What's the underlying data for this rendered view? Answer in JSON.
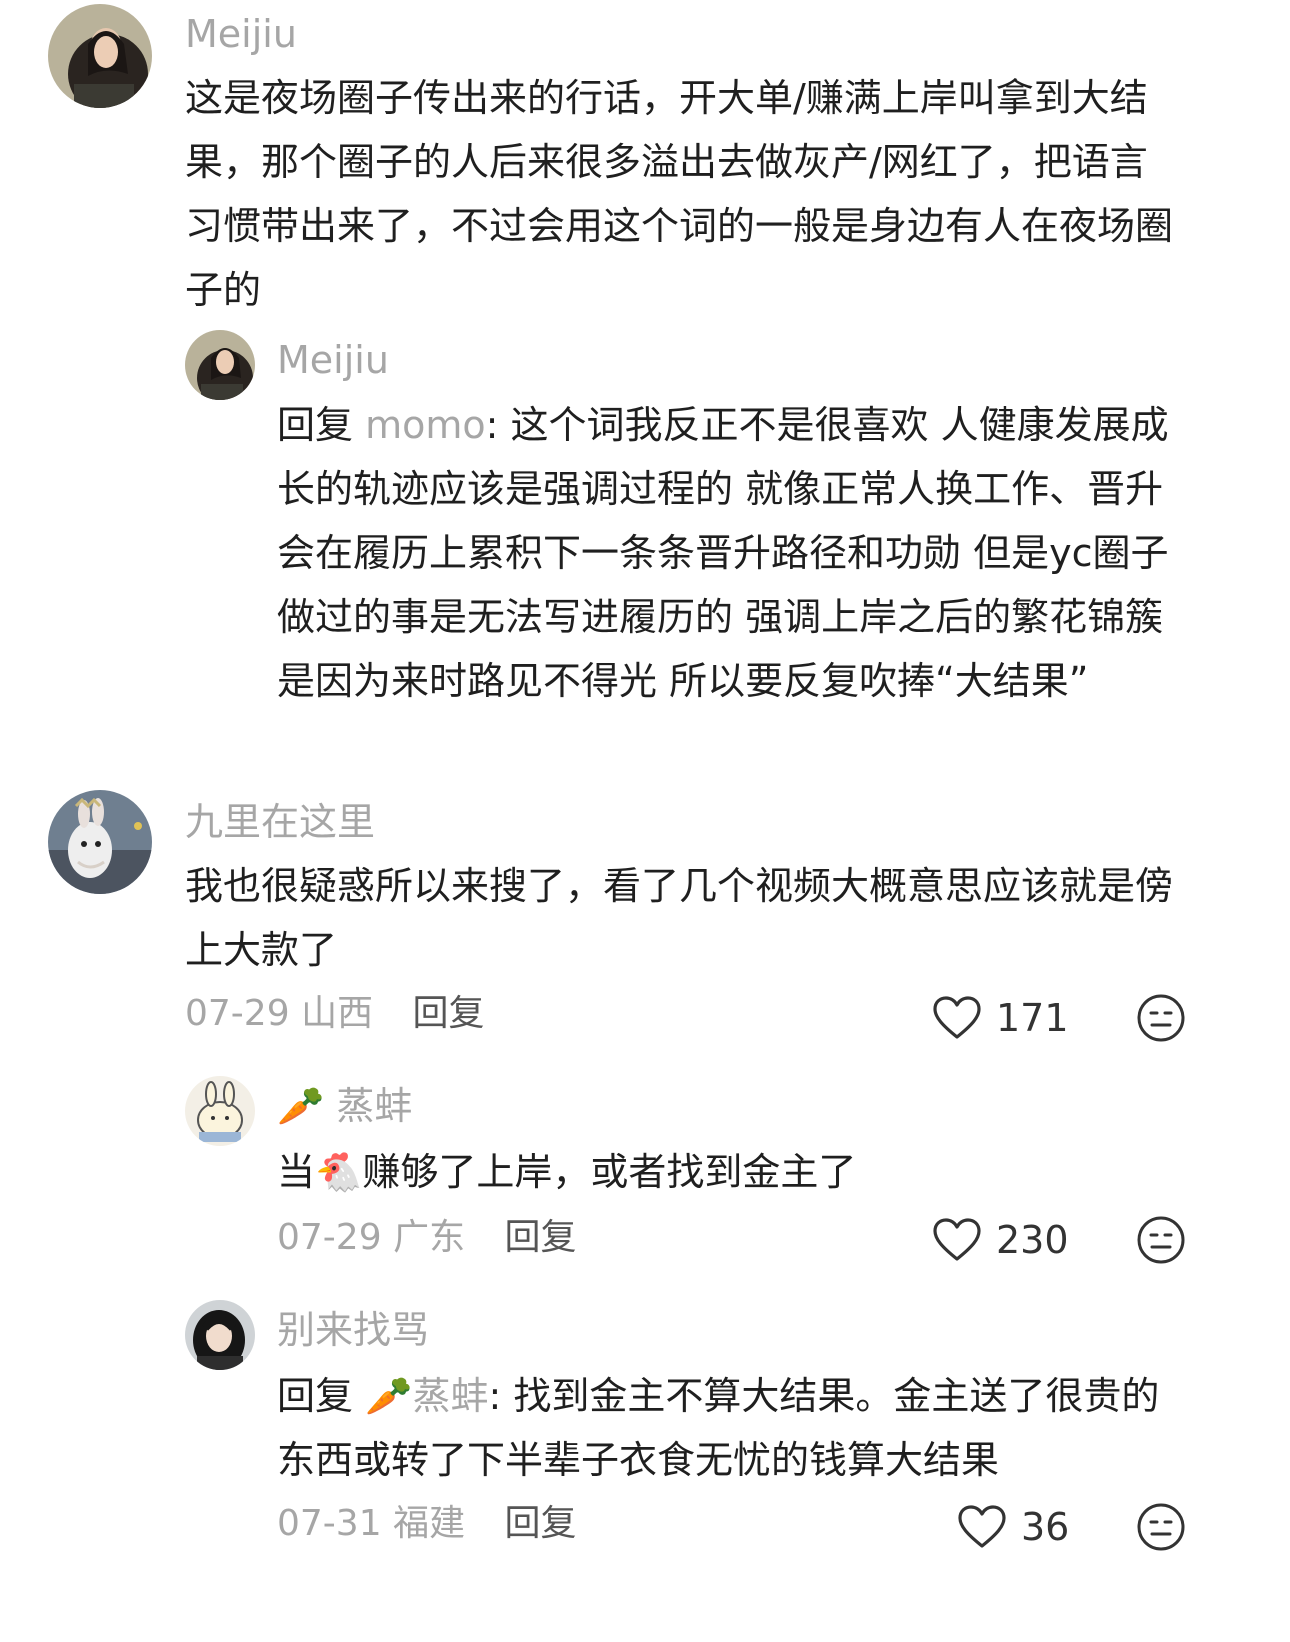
{
  "comments": [
    {
      "name": "Meijiu",
      "avatar": "woman-photo-avatar",
      "text": "这是夜场圈子传出来的行话，开大单/赚满上岸叫拿到大结果，那个圈子的人后来很多溢出去做灰产/网红了，把语言习惯带出来了，不过会用这个词的一般是身边有人在夜场圈子的",
      "replies": [
        {
          "name": "Meijiu",
          "avatar": "woman-photo-avatar",
          "reply_prefix": "回复",
          "mention": "momo",
          "text": ": 这个词我反正不是很喜欢 人健康发展成长的轨迹应该是强调过程的 就像正常人换工作、晋升会在履历上累积下一条条晋升路径和功勋 但是yc圈子做过的事是无法写进履历的 强调上岸之后的繁花锦簇 是因为来时路见不得光 所以要反复吹捧“大结果”"
        }
      ]
    },
    {
      "name": "九里在这里",
      "avatar": "rabbit-photo-avatar",
      "text": "我也很疑惑所以来搜了，看了几个视频大概意思应该就是傍上大款了",
      "date": "07-29",
      "location": "山西",
      "reply_label": "回复",
      "likes": "171",
      "replies": [
        {
          "name_emoji": "🥕",
          "name": "蒸蚌",
          "avatar": "cartoon-bunny-avatar",
          "text_before": "当",
          "text_emoji": "🐔",
          "text_after": "赚够了上岸，或者找到金主了",
          "date": "07-29",
          "location": "广东",
          "reply_label": "回复",
          "likes": "230"
        },
        {
          "name": "别来找骂",
          "avatar": "girl-photo-avatar",
          "reply_prefix": "回复",
          "mention_emoji": "🥕",
          "mention": "蒸蚌",
          "text": ": 找到金主不算大结果。金主送了很贵的东西或转了下半辈子衣食无忧的钱算大结果",
          "date": "07-31",
          "location": "福建",
          "reply_label": "回复",
          "likes": "36"
        }
      ]
    }
  ]
}
